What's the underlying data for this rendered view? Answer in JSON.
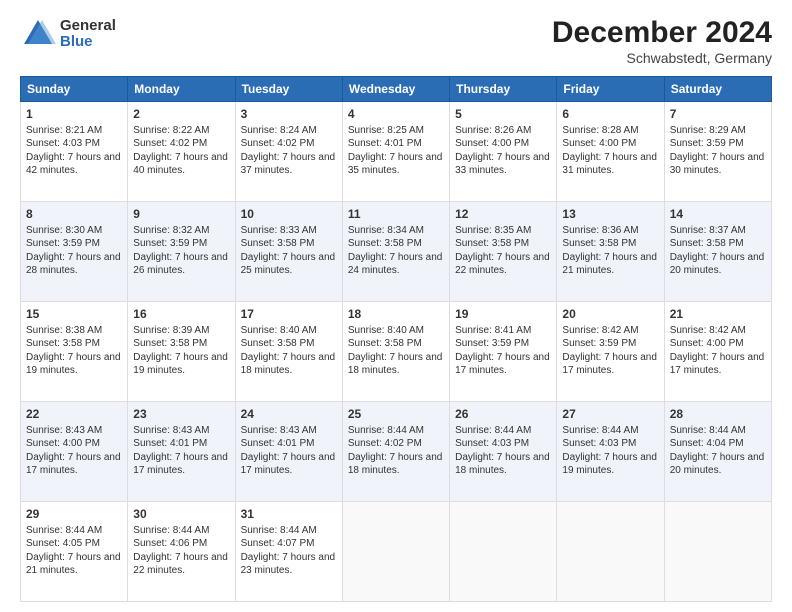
{
  "logo": {
    "general": "General",
    "blue": "Blue"
  },
  "header": {
    "month": "December 2024",
    "location": "Schwabstedt, Germany"
  },
  "columns": [
    "Sunday",
    "Monday",
    "Tuesday",
    "Wednesday",
    "Thursday",
    "Friday",
    "Saturday"
  ],
  "weeks": [
    [
      {
        "day": "1",
        "sunrise": "8:21 AM",
        "sunset": "4:03 PM",
        "daylight": "7 hours and 42 minutes."
      },
      {
        "day": "2",
        "sunrise": "8:22 AM",
        "sunset": "4:02 PM",
        "daylight": "7 hours and 40 minutes."
      },
      {
        "day": "3",
        "sunrise": "8:24 AM",
        "sunset": "4:02 PM",
        "daylight": "7 hours and 37 minutes."
      },
      {
        "day": "4",
        "sunrise": "8:25 AM",
        "sunset": "4:01 PM",
        "daylight": "7 hours and 35 minutes."
      },
      {
        "day": "5",
        "sunrise": "8:26 AM",
        "sunset": "4:00 PM",
        "daylight": "7 hours and 33 minutes."
      },
      {
        "day": "6",
        "sunrise": "8:28 AM",
        "sunset": "4:00 PM",
        "daylight": "7 hours and 31 minutes."
      },
      {
        "day": "7",
        "sunrise": "8:29 AM",
        "sunset": "3:59 PM",
        "daylight": "7 hours and 30 minutes."
      }
    ],
    [
      {
        "day": "8",
        "sunrise": "8:30 AM",
        "sunset": "3:59 PM",
        "daylight": "7 hours and 28 minutes."
      },
      {
        "day": "9",
        "sunrise": "8:32 AM",
        "sunset": "3:59 PM",
        "daylight": "7 hours and 26 minutes."
      },
      {
        "day": "10",
        "sunrise": "8:33 AM",
        "sunset": "3:58 PM",
        "daylight": "7 hours and 25 minutes."
      },
      {
        "day": "11",
        "sunrise": "8:34 AM",
        "sunset": "3:58 PM",
        "daylight": "7 hours and 24 minutes."
      },
      {
        "day": "12",
        "sunrise": "8:35 AM",
        "sunset": "3:58 PM",
        "daylight": "7 hours and 22 minutes."
      },
      {
        "day": "13",
        "sunrise": "8:36 AM",
        "sunset": "3:58 PM",
        "daylight": "7 hours and 21 minutes."
      },
      {
        "day": "14",
        "sunrise": "8:37 AM",
        "sunset": "3:58 PM",
        "daylight": "7 hours and 20 minutes."
      }
    ],
    [
      {
        "day": "15",
        "sunrise": "8:38 AM",
        "sunset": "3:58 PM",
        "daylight": "7 hours and 19 minutes."
      },
      {
        "day": "16",
        "sunrise": "8:39 AM",
        "sunset": "3:58 PM",
        "daylight": "7 hours and 19 minutes."
      },
      {
        "day": "17",
        "sunrise": "8:40 AM",
        "sunset": "3:58 PM",
        "daylight": "7 hours and 18 minutes."
      },
      {
        "day": "18",
        "sunrise": "8:40 AM",
        "sunset": "3:58 PM",
        "daylight": "7 hours and 18 minutes."
      },
      {
        "day": "19",
        "sunrise": "8:41 AM",
        "sunset": "3:59 PM",
        "daylight": "7 hours and 17 minutes."
      },
      {
        "day": "20",
        "sunrise": "8:42 AM",
        "sunset": "3:59 PM",
        "daylight": "7 hours and 17 minutes."
      },
      {
        "day": "21",
        "sunrise": "8:42 AM",
        "sunset": "4:00 PM",
        "daylight": "7 hours and 17 minutes."
      }
    ],
    [
      {
        "day": "22",
        "sunrise": "8:43 AM",
        "sunset": "4:00 PM",
        "daylight": "7 hours and 17 minutes."
      },
      {
        "day": "23",
        "sunrise": "8:43 AM",
        "sunset": "4:01 PM",
        "daylight": "7 hours and 17 minutes."
      },
      {
        "day": "24",
        "sunrise": "8:43 AM",
        "sunset": "4:01 PM",
        "daylight": "7 hours and 17 minutes."
      },
      {
        "day": "25",
        "sunrise": "8:44 AM",
        "sunset": "4:02 PM",
        "daylight": "7 hours and 18 minutes."
      },
      {
        "day": "26",
        "sunrise": "8:44 AM",
        "sunset": "4:03 PM",
        "daylight": "7 hours and 18 minutes."
      },
      {
        "day": "27",
        "sunrise": "8:44 AM",
        "sunset": "4:03 PM",
        "daylight": "7 hours and 19 minutes."
      },
      {
        "day": "28",
        "sunrise": "8:44 AM",
        "sunset": "4:04 PM",
        "daylight": "7 hours and 20 minutes."
      }
    ],
    [
      {
        "day": "29",
        "sunrise": "8:44 AM",
        "sunset": "4:05 PM",
        "daylight": "7 hours and 21 minutes."
      },
      {
        "day": "30",
        "sunrise": "8:44 AM",
        "sunset": "4:06 PM",
        "daylight": "7 hours and 22 minutes."
      },
      {
        "day": "31",
        "sunrise": "8:44 AM",
        "sunset": "4:07 PM",
        "daylight": "7 hours and 23 minutes."
      },
      null,
      null,
      null,
      null
    ]
  ]
}
